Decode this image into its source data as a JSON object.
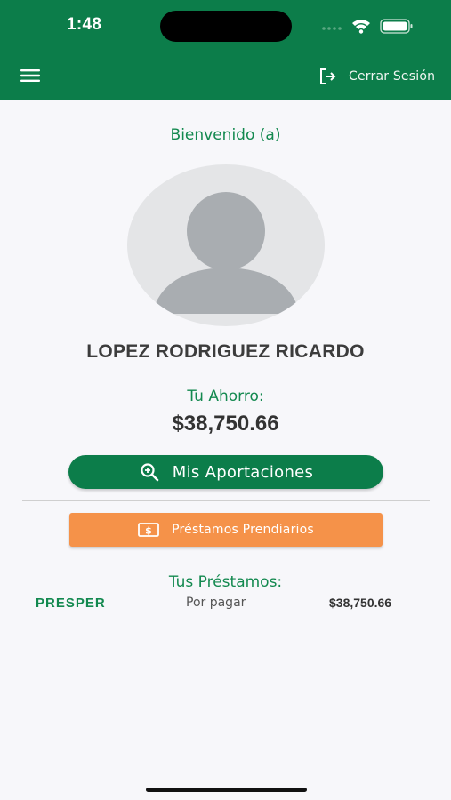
{
  "status_bar": {
    "time": "1:48"
  },
  "header": {
    "logout_label": "Cerrar Sesión",
    "background": "#0c7d4a"
  },
  "profile": {
    "welcome": "Bienvenido (a)",
    "name": "LOPEZ RODRIGUEZ RICARDO",
    "savings_label": "Tu Ahorro:",
    "savings_amount": "$38,750.66"
  },
  "actions": {
    "contributions_label": "Mis Aportaciones",
    "pawn_loans_label": "Préstamos Prendiarios",
    "accent_orange": "#f59249"
  },
  "loans": {
    "title": "Tus Préstamos:",
    "items": [
      {
        "type": "PRESPER",
        "status": "Por pagar",
        "amount": "$38,750.66"
      }
    ]
  }
}
